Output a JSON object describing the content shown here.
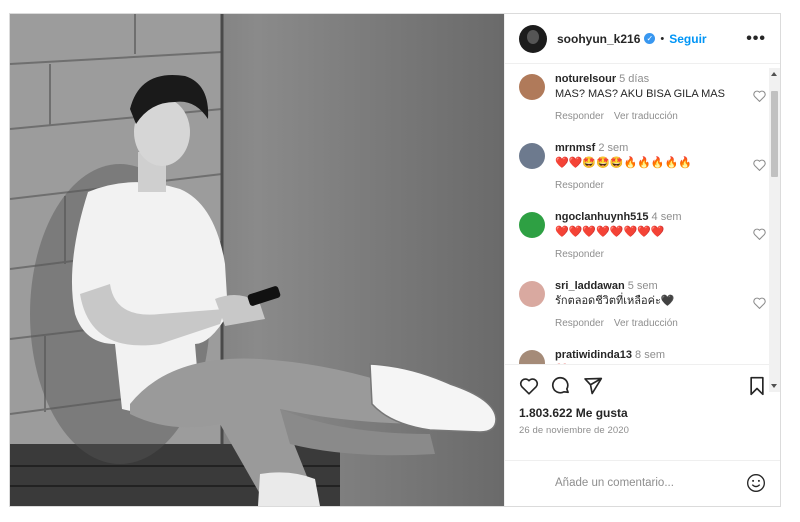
{
  "post": {
    "author": "soohyun_k216",
    "follow_label": "Seguir",
    "separator": "•",
    "more_label": "•••",
    "likes": "1.803.622 Me gusta",
    "date": "26 de noviembre de 2020",
    "comment_placeholder": "Añade un comentario...",
    "verified_mark": "✓"
  },
  "colors": {
    "link": "#0095f6",
    "verified": "#3897f0",
    "muted": "#8e8e8e",
    "text": "#262626"
  },
  "comments": [
    {
      "user": "noturelsour",
      "time": "5 días",
      "text": "MAS? MAS? AKU BISA GILA MAS",
      "reply": "Responder",
      "translate": "Ver traducción",
      "avatar_color": "#b07a5a"
    },
    {
      "user": "mrnmsf",
      "time": "2 sem",
      "text": "❤️❤️🤩🤩🤩🔥🔥🔥🔥🔥",
      "reply": "Responder",
      "translate": "",
      "avatar_color": "#6d7a8e"
    },
    {
      "user": "ngoclanhuynh515",
      "time": "4 sem",
      "text": "❤️❤️❤️❤️❤️❤️❤️❤️",
      "reply": "Responder",
      "translate": "",
      "avatar_color": "#2ea043"
    },
    {
      "user": "sri_laddawan",
      "time": "5 sem",
      "text": "รักตลอดชีวิตที่เหลือค่ะ🖤",
      "reply": "Responder",
      "translate": "Ver traducción",
      "avatar_color": "#d9a9a0"
    },
    {
      "user": "pratiwidinda13",
      "time": "8 sem",
      "text": "❤️",
      "reply": "",
      "translate": "",
      "avatar_color": "#a58b78"
    }
  ],
  "icons": [
    "heart-icon",
    "comment-icon",
    "share-icon",
    "bookmark-icon",
    "emoji-icon",
    "more-icon",
    "verified-icon"
  ]
}
